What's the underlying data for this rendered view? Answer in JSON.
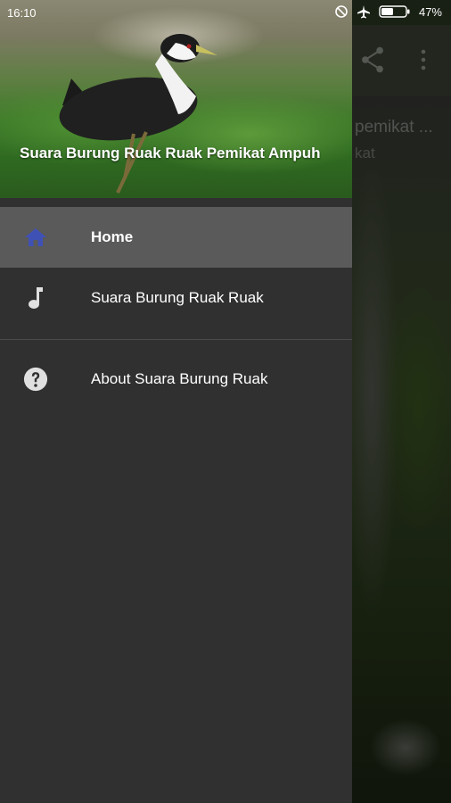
{
  "status_bar": {
    "time": "16:10",
    "battery_percent": "47%",
    "icons": [
      "do-not-disturb-icon",
      "airplane-mode-icon",
      "battery-icon"
    ]
  },
  "background_app": {
    "title": "pemikat ...",
    "subtitle": "kat",
    "actions": [
      "share-icon",
      "more-vert-icon"
    ]
  },
  "drawer": {
    "header_title": "Suara Burung Ruak Ruak Pemikat Ampuh",
    "items": [
      {
        "label": "Home",
        "icon": "home-icon",
        "active": true
      },
      {
        "label": "Suara Burung Ruak Ruak",
        "icon": "music-note-icon",
        "active": false
      }
    ],
    "secondary_items": [
      {
        "label": "About Suara Burung Ruak",
        "icon": "help-icon",
        "active": false
      }
    ]
  },
  "colors": {
    "drawer_bg": "#303030",
    "active_item_bg": "#5a5a5a",
    "home_icon": "#3f51b5",
    "icon_default": "#e0e0e0"
  }
}
